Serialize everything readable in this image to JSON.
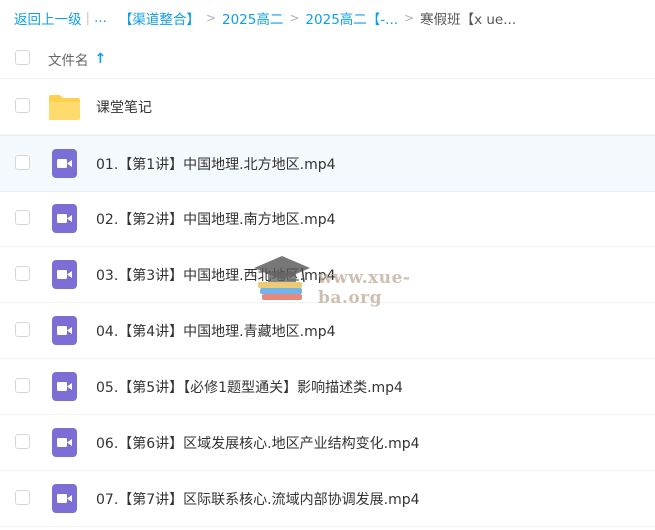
{
  "breadcrumb": {
    "back": "返回上一级",
    "ellipsis": "...",
    "items": [
      "【渠道整合】",
      "2025高二",
      "2025高二【-...",
      "寒假班【x ue..."
    ]
  },
  "header": {
    "name_label": "文件名",
    "sort_icon": "arrow-up-icon"
  },
  "files": [
    {
      "type": "folder",
      "name": "课堂笔记"
    },
    {
      "type": "video",
      "name": "01.【第1讲】中国地理.北方地区.mp4"
    },
    {
      "type": "video",
      "name": "02.【第2讲】中国地理.南方地区.mp4"
    },
    {
      "type": "video",
      "name": "03.【第3讲】中国地理.西北地区.mp4"
    },
    {
      "type": "video",
      "name": "04.【第4讲】中国地理.青藏地区.mp4"
    },
    {
      "type": "video",
      "name": "05.【第5讲】【必修1题型通关】影响描述类.mp4"
    },
    {
      "type": "video",
      "name": "06.【第6讲】区域发展核心.地区产业结构变化.mp4"
    },
    {
      "type": "video",
      "name": "07.【第7讲】区际联系核心.流域内部协调发展.mp4"
    }
  ],
  "watermark": {
    "text": "www.xue-ba.org"
  },
  "colors": {
    "accent": "#0f9ee8",
    "folder": "#ffd04c",
    "video": "#7b6fd6",
    "highlight": "#f4f9fd"
  }
}
